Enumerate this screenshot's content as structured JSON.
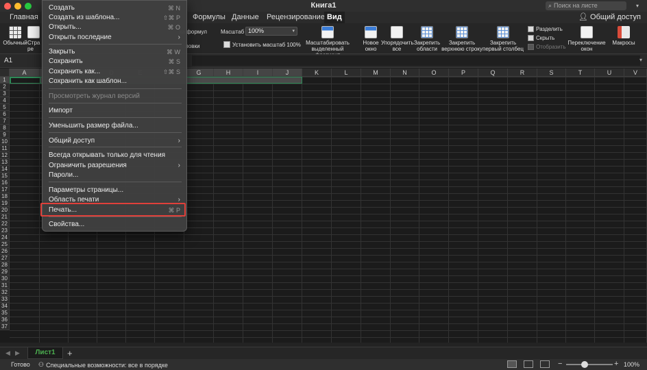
{
  "window": {
    "title": "Книга1",
    "search_placeholder": "Поиск на листе",
    "share_label": "Общий доступ"
  },
  "tabs": [
    "Главная",
    "Формулы",
    "Данные",
    "Рецензирование",
    "Вид"
  ],
  "ribbon": {
    "normal": "Обычный",
    "page_layout_partial": "Стра",
    "page_layout_partial2": "ре",
    "formula_bar_partial": "ка формул",
    "headings_partial": "ловки",
    "zoom_label": "Масштаб",
    "zoom_value": "100%",
    "fit_100": "Установить масштаб 100%",
    "zoom_selection": [
      "Масштабировать",
      "выделенный фрагмент"
    ],
    "new_window": [
      "Новое",
      "окно"
    ],
    "arrange_all": [
      "Упорядочить",
      "все"
    ],
    "freeze_panes": [
      "Закрепить",
      "области"
    ],
    "freeze_top_row": [
      "Закрепить",
      "верхнюю строку"
    ],
    "freeze_first_col": [
      "Закрепить",
      "первый столбец"
    ],
    "split": "Разделить",
    "hide": "Скрыть",
    "unhide": "Отобразить",
    "switch_windows": [
      "Переключение",
      "окон"
    ],
    "macros": "Макросы"
  },
  "formula_bar": {
    "name_box": "A1"
  },
  "columns": [
    "A",
    "B",
    "C",
    "D",
    "E",
    "F",
    "G",
    "H",
    "I",
    "J",
    "K",
    "L",
    "M",
    "N",
    "O",
    "P",
    "Q",
    "R",
    "S",
    "T",
    "U",
    "V"
  ],
  "rows": [
    "1",
    "2",
    "3",
    "4",
    "5",
    "6",
    "7",
    "8",
    "9",
    "10",
    "11",
    "12",
    "13",
    "14",
    "15",
    "16",
    "17",
    "18",
    "19",
    "20",
    "21",
    "22",
    "23",
    "24",
    "25",
    "26",
    "27",
    "28",
    "29",
    "30",
    "31",
    "32",
    "33",
    "34",
    "35",
    "36",
    "37"
  ],
  "menu": {
    "items": [
      {
        "label": "Создать",
        "shortcut": "⌘ N"
      },
      {
        "label": "Создать из шаблона...",
        "shortcut": "⇧⌘ P"
      },
      {
        "label": "Открыть...",
        "shortcut": "⌘ O"
      },
      {
        "label": "Открыть последние",
        "arrow": "›"
      },
      {
        "label": "Закрыть",
        "shortcut": "⌘ W"
      },
      {
        "label": "Сохранить",
        "shortcut": "⌘ S"
      },
      {
        "label": "Сохранить как...",
        "shortcut": "⇧⌘ S"
      },
      {
        "label": "Сохранить как шаблон..."
      },
      {
        "label": "Просмотреть журнал версий"
      },
      {
        "label": "Импорт"
      },
      {
        "label": "Уменьшить размер файла..."
      },
      {
        "label": "Общий доступ",
        "arrow": "›"
      },
      {
        "label": "Всегда открывать только для чтения"
      },
      {
        "label": "Ограничить разрешения",
        "arrow": "›"
      },
      {
        "label": "Пароли..."
      },
      {
        "label": "Параметры страницы..."
      },
      {
        "label": "Область печати",
        "arrow": "›"
      },
      {
        "label": "Печать...",
        "shortcut": "⌘ P"
      },
      {
        "label": "Свойства..."
      }
    ]
  },
  "sheet_tabs": {
    "active": "Лист1",
    "add": "+"
  },
  "status": {
    "ready": "Готово",
    "accessibility": "Специальные возможности: все в порядке",
    "zoom": "100%"
  }
}
